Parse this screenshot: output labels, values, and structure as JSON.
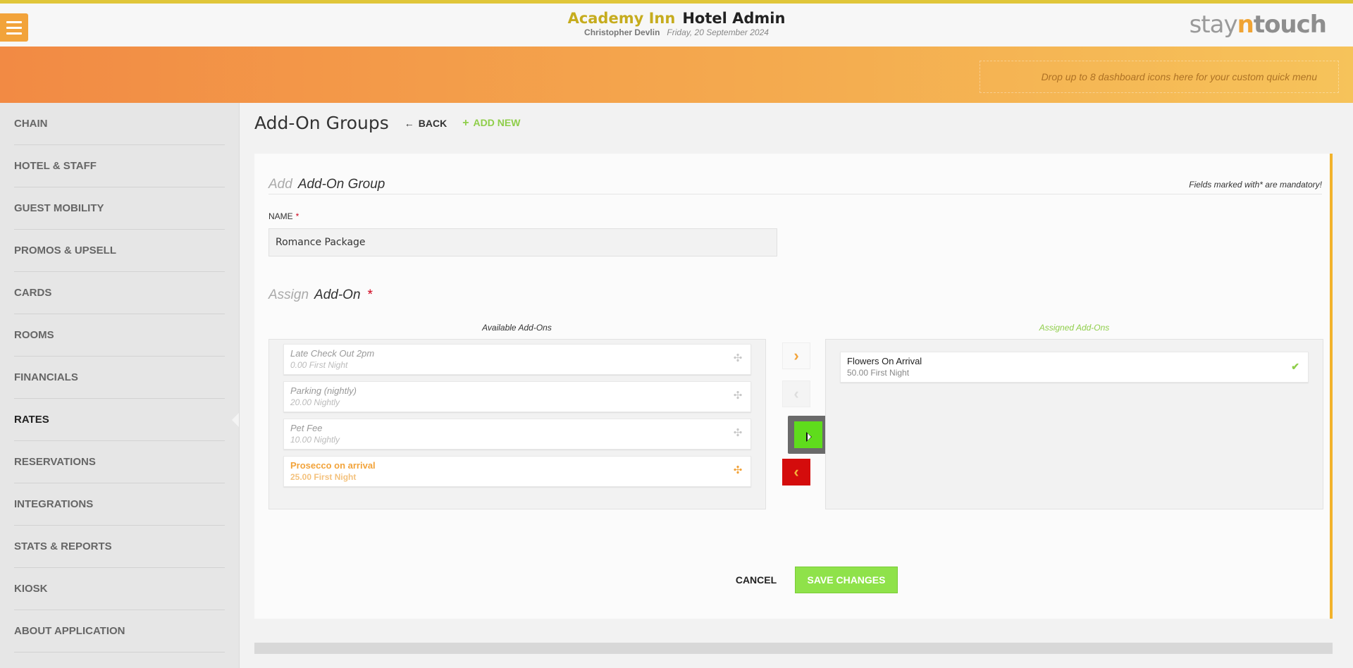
{
  "header": {
    "hotel_name": "Academy Inn",
    "app_title": "Hotel Admin",
    "user_name": "Christopher Devlin",
    "date": "Friday, 20 September 2024",
    "logo_part1": "stay",
    "logo_part2": "n",
    "logo_part3": "touch",
    "menu_icon": "hamburger-icon",
    "accent_color": "#f2a33a"
  },
  "banner": {
    "quick_menu_text": "Drop up to 8 dashboard icons here for your custom quick menu"
  },
  "sidebar": {
    "items": [
      {
        "label": "CHAIN"
      },
      {
        "label": "HOTEL & STAFF"
      },
      {
        "label": "GUEST MOBILITY"
      },
      {
        "label": "PROMOS & UPSELL"
      },
      {
        "label": "CARDS"
      },
      {
        "label": "ROOMS"
      },
      {
        "label": "FINANCIALS"
      },
      {
        "label": "RATES",
        "active": true
      },
      {
        "label": "RESERVATIONS"
      },
      {
        "label": "INTEGRATIONS"
      },
      {
        "label": "STATS & REPORTS"
      },
      {
        "label": "KIOSK"
      },
      {
        "label": "ABOUT APPLICATION"
      }
    ]
  },
  "page": {
    "title": "Add-On Groups",
    "back_label": "BACK",
    "back_icon": "←",
    "add_new_label": "ADD NEW",
    "add_new_icon": "+"
  },
  "form": {
    "heading_muted": "Add",
    "heading": "Add-On Group",
    "mandatory_note": "Fields marked with* are mandatory!",
    "name_label": "NAME",
    "required_mark": "*",
    "name_value": "Romance Package",
    "assign_muted": "Assign",
    "assign_heading": "Add-On",
    "available_title": "Available Add-Ons",
    "assigned_title": "Assigned Add-Ons",
    "available_addons": [
      {
        "name": "Late Check Out 2pm",
        "price": "0.00 First Night"
      },
      {
        "name": "Parking (nightly)",
        "price": "20.00 Nightly"
      },
      {
        "name": "Pet Fee",
        "price": "10.00 Nightly"
      },
      {
        "name": "Prosecco on arrival",
        "price": "25.00 First Night",
        "highlighted": true
      }
    ],
    "assigned_addons": [
      {
        "name": "Flowers On Arrival",
        "price": "50.00 First Night"
      }
    ],
    "move_right_icon": "›",
    "move_left_icon": "‹",
    "move_all_left_icon": "‹",
    "drag_icon": "✣",
    "check_icon": "✔",
    "cancel_label": "CANCEL",
    "save_label": "SAVE CHANGES"
  }
}
